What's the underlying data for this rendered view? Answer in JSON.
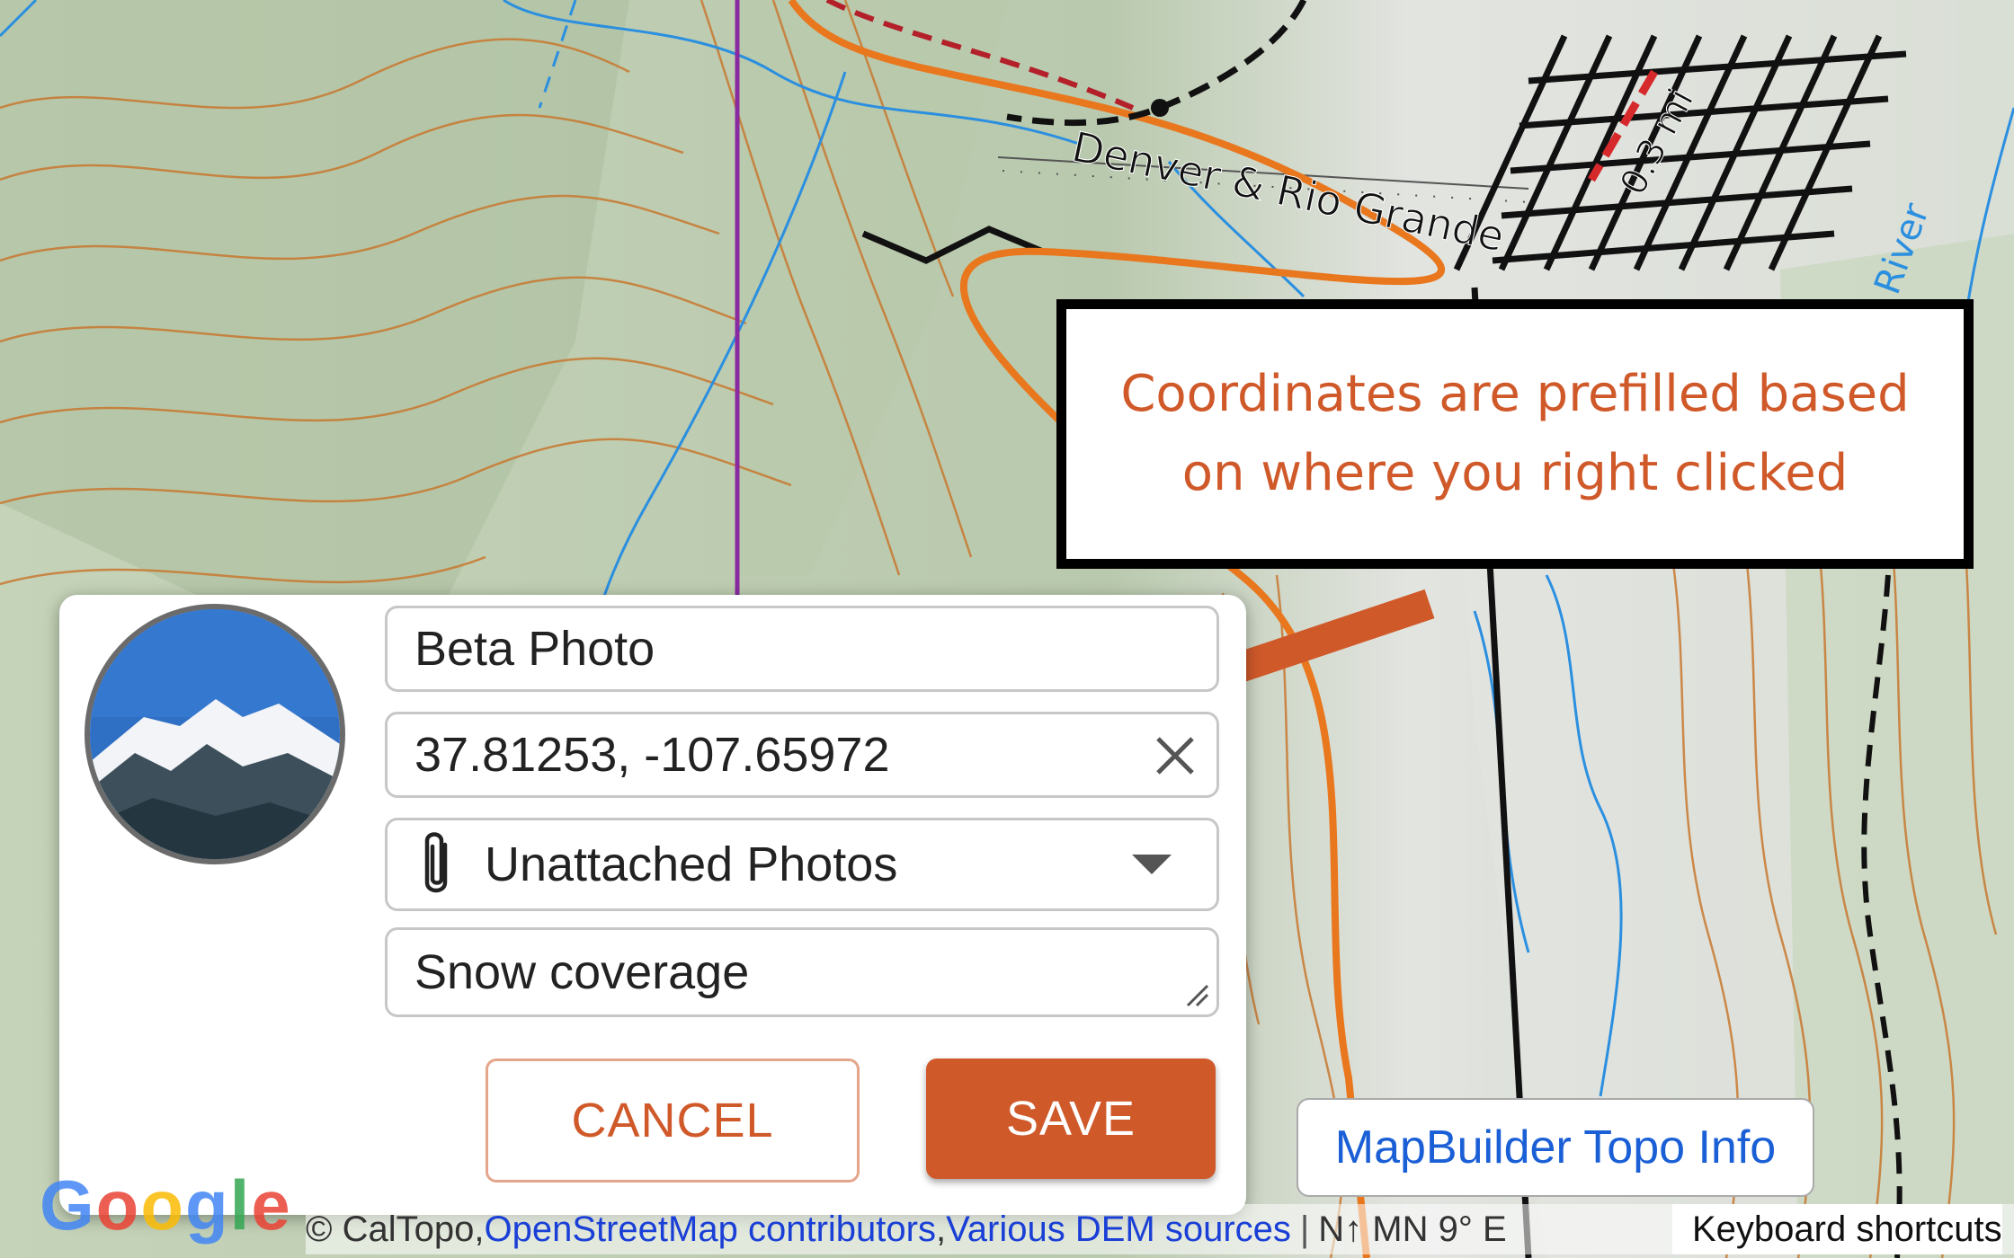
{
  "map": {
    "road_label": "Denver & Rio Grande",
    "distance_label": "0.3 mi",
    "river_label": "River"
  },
  "callout": {
    "text": "Coordinates are prefilled based on where you right clicked"
  },
  "marker_dialog": {
    "title_value": "Beta Photo",
    "coords_value": "37.81253, -107.65972",
    "folder_selected": "Unattached Photos",
    "notes_value": "Snow coverage",
    "cancel_label": "CANCEL",
    "save_label": "SAVE"
  },
  "info_button": {
    "label": "MapBuilder Topo Info"
  },
  "attribution": {
    "prefix": "© CalTopo, ",
    "osm": "OpenStreetMap contributors",
    "sep": ", ",
    "dem": "Various DEM sources",
    "north": "N↑ MN 9° E"
  },
  "keyboard_shortcuts": "Keyboard shortcuts",
  "google_logo": "Google",
  "colors": {
    "accent": "#d0592a",
    "link": "#1a5fd6",
    "contour": "#c8782f",
    "water": "#2b8fe0",
    "trail": "#e8771e"
  }
}
